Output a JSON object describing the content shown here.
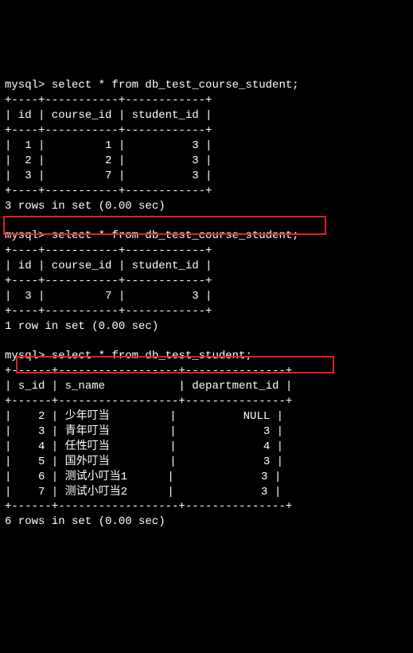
{
  "query1": {
    "prompt": "mysql> ",
    "sql": "select * from db_test_course_student;",
    "border_top": "+----+-----------+------------+",
    "header": "| id | course_id | student_id |",
    "border_mid": "+----+-----------+------------+",
    "rows": [
      "|  1 |         1 |          3 |",
      "|  2 |         2 |          3 |",
      "|  3 |         7 |          3 |"
    ],
    "border_bot": "+----+-----------+------------+",
    "status": "3 rows in set (0.00 sec)"
  },
  "query2": {
    "prompt": "mysql> ",
    "sql": "select * from db_test_course_student;",
    "border_top": "+----+-----------+------------+",
    "header": "| id | course_id | student_id |",
    "border_mid": "+----+-----------+------------+",
    "rows": [
      "|  3 |         7 |          3 |"
    ],
    "border_bot": "+----+-----------+------------+",
    "status": "1 row in set (0.00 sec)"
  },
  "query3": {
    "prompt": "mysql> ",
    "sql": "select * from db_test_student;",
    "border_top": "+------+------------------+---------------+",
    "header": "| s_id | s_name           | department_id |",
    "border_mid": "+------+------------------+---------------+",
    "rows": [
      "|    2 | 少年叮当         |          NULL |",
      "|    3 | 青年叮当         |             3 |",
      "|    4 | 任性叮当         |             4 |",
      "|    5 | 国外叮当         |             3 |",
      "|    6 | 测试小叮当1      |             3 |",
      "|    7 | 测试小叮当2      |             3 |"
    ],
    "border_bot": "+------+------------------+---------------+",
    "status": "6 rows in set (0.00 sec)"
  }
}
